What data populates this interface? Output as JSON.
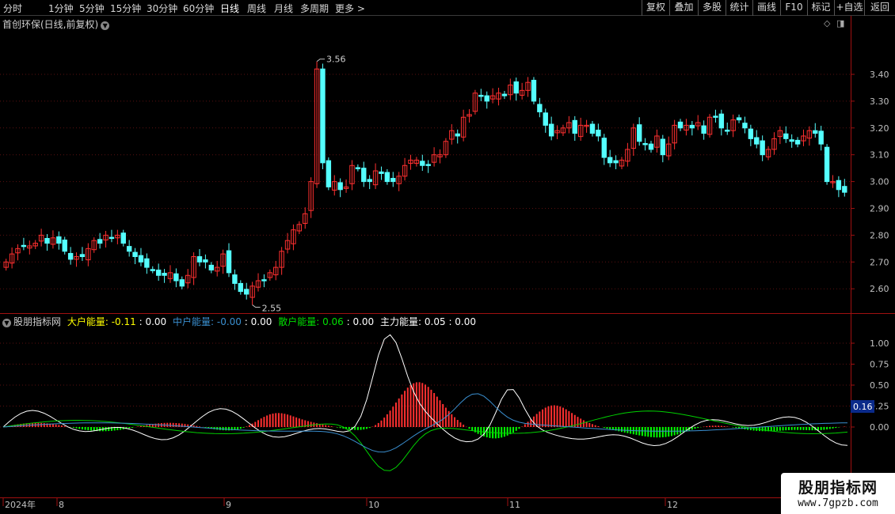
{
  "toolbar": {
    "periods": [
      "分时",
      "1分钟",
      "5分钟",
      "15分钟",
      "30分钟",
      "60分钟",
      "日线",
      "周线",
      "月线",
      "多周期",
      "更多 >"
    ],
    "active": "日线",
    "buttons": [
      "复权",
      "叠加",
      "多股",
      "统计",
      "画线",
      "F10",
      "标记",
      "+自选",
      "返回"
    ]
  },
  "main_chart": {
    "title": "首创环保(日线,前复权)",
    "high_label": "3.56",
    "low_label": "2.55",
    "y_labels": [
      "3.40",
      "3.30",
      "3.20",
      "3.10",
      "3.00",
      "2.90",
      "2.80",
      "2.70",
      "2.60"
    ]
  },
  "indicator": {
    "name": "股朋指标网",
    "items": [
      {
        "label": "大户能量:",
        "value": "-0.11",
        "sep": ": 0.00",
        "color": "#ffff00"
      },
      {
        "label": "中户能量:",
        "value": "-0.00",
        "sep": ": 0.00",
        "color": "#3a8fd0"
      },
      {
        "label": "散户能量:",
        "value": "0.06",
        "sep": ": 0.00",
        "color": "#00e000"
      },
      {
        "label": "主力能量:",
        "value": "0.05",
        "sep": ": 0.00",
        "color": "#ffffff"
      }
    ],
    "y_labels": [
      "1.00",
      "0.75",
      "0.50",
      "0.25",
      "0.00"
    ],
    "current_value": "0.16"
  },
  "time_axis": {
    "labels": [
      "2024年",
      "8",
      "9",
      "10",
      "11",
      "12"
    ]
  },
  "watermark": {
    "line1": "股朋指标网",
    "line2": "www.7gpzb.com"
  },
  "colors": {
    "up": "#ff3030",
    "down": "#54ffff",
    "grid": "#5a1010",
    "axis": "#a01010"
  },
  "chart_data": {
    "type": "candlestick",
    "series": [
      {
        "name": "close",
        "values": [
          2.7,
          2.73,
          2.75,
          2.76,
          2.76,
          2.77,
          2.8,
          2.77,
          2.79,
          2.77,
          2.74,
          2.71,
          2.72,
          2.72,
          2.75,
          2.78,
          2.77,
          2.8,
          2.79,
          2.8,
          2.77,
          2.74,
          2.72,
          2.7,
          2.68,
          2.67,
          2.65,
          2.65,
          2.66,
          2.63,
          2.61,
          2.65,
          2.72,
          2.7,
          2.7,
          2.67,
          2.68,
          2.73,
          2.66,
          2.62,
          2.59,
          2.58,
          2.61,
          2.63,
          2.63,
          2.66,
          2.68,
          2.74,
          2.78,
          2.82,
          2.84,
          2.88,
          3.0,
          3.42,
          3.07,
          2.98,
          3.0,
          2.97,
          2.98,
          3.06,
          3.05,
          3.0,
          3.0,
          3.04,
          3.03,
          3.0,
          3.0,
          3.02,
          3.06,
          3.08,
          3.08,
          3.06,
          3.06,
          3.1,
          3.1,
          3.15,
          3.19,
          3.17,
          3.24,
          3.25,
          3.33,
          3.32,
          3.3,
          3.32,
          3.33,
          3.32,
          3.36,
          3.33,
          3.34,
          3.37,
          3.3,
          3.26,
          3.21,
          3.17,
          3.19,
          3.2,
          3.22,
          3.18,
          3.21,
          3.21,
          3.18,
          3.17,
          3.09,
          3.07,
          3.07,
          3.08,
          3.12,
          3.2,
          3.15,
          3.14,
          3.12,
          3.17,
          3.1,
          3.14,
          3.21,
          3.2,
          3.21,
          3.2,
          3.22,
          3.18,
          3.24,
          3.24,
          3.2,
          3.19,
          3.23,
          3.23,
          3.2,
          3.16,
          3.14,
          3.1,
          3.12,
          3.16,
          3.19,
          3.16,
          3.15,
          3.14,
          3.17,
          3.19,
          3.18,
          3.14,
          3.0,
          3.0,
          2.97,
          2.96
        ]
      }
    ]
  }
}
